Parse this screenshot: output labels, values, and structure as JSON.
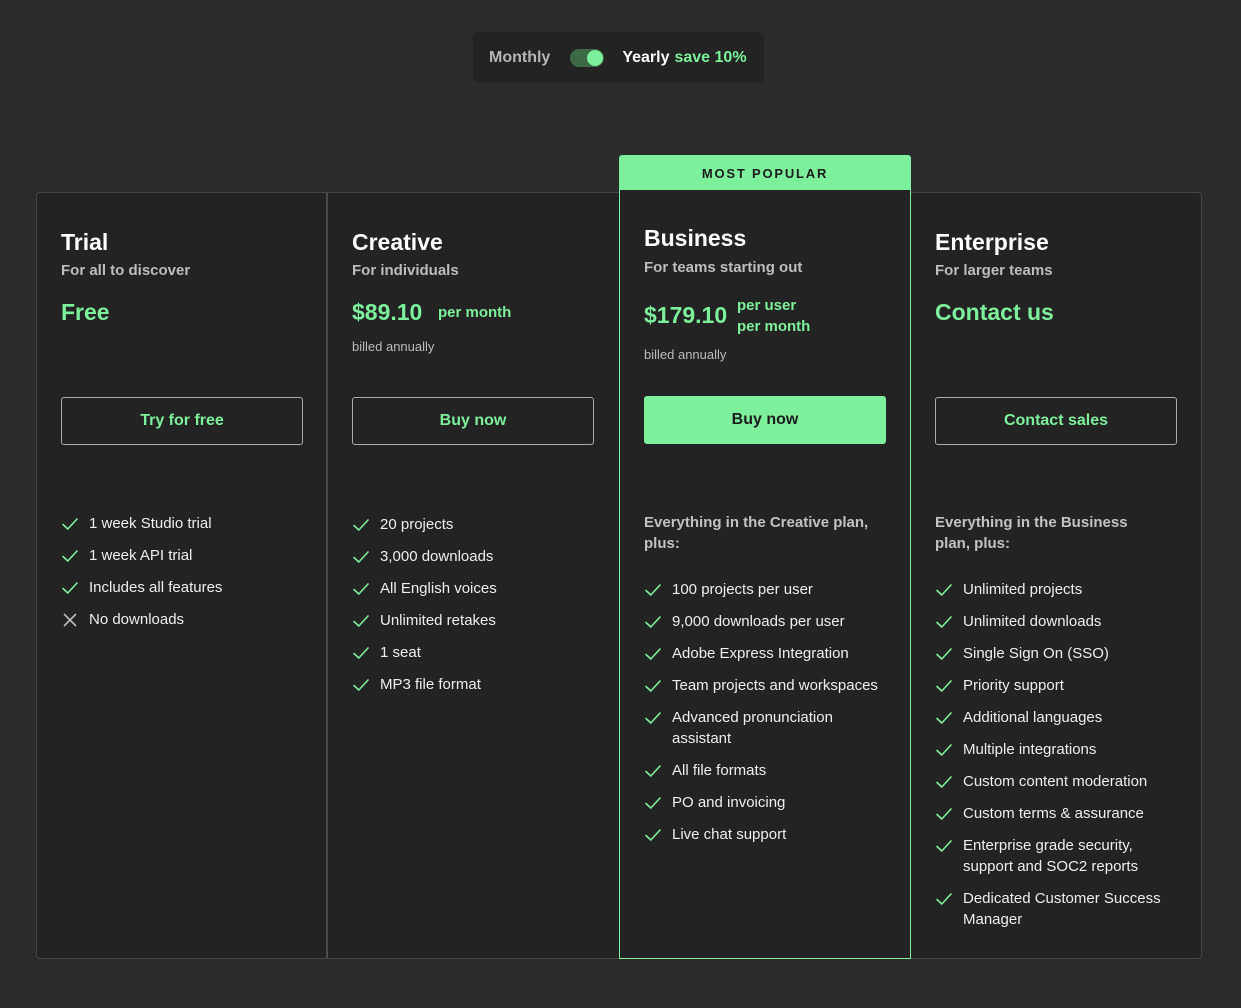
{
  "toggle": {
    "monthly": "Monthly",
    "yearly": "Yearly",
    "save": "save 10%"
  },
  "plans": [
    {
      "name": "Trial",
      "subtitle": "For all to discover",
      "price": "Free",
      "cta": "Try for free",
      "features": [
        {
          "text": "1 week Studio trial",
          "icon": "check-icon"
        },
        {
          "text": "1 week API trial",
          "icon": "check-icon"
        },
        {
          "text": "Includes all features",
          "icon": "check-icon"
        },
        {
          "text": "No downloads",
          "icon": "x-icon"
        }
      ]
    },
    {
      "name": "Creative",
      "subtitle": "For individuals",
      "price": "$89.10",
      "period": "per month",
      "billed": "billed annually",
      "cta": "Buy now",
      "features": [
        {
          "text": "20 projects",
          "icon": "check-icon"
        },
        {
          "text": "3,000 downloads",
          "icon": "check-icon"
        },
        {
          "text": "All English voices",
          "icon": "check-icon"
        },
        {
          "text": "Unlimited retakes",
          "icon": "check-icon"
        },
        {
          "text": "1 seat",
          "icon": "check-icon"
        },
        {
          "text": "MP3 file format",
          "icon": "check-icon"
        }
      ]
    },
    {
      "badge": "MOST POPULAR",
      "name": "Business",
      "subtitle": "For teams starting out",
      "price": "$179.10",
      "period_line1": "per user",
      "period_line2": "per month",
      "billed": "billed annually",
      "cta": "Buy now",
      "intro": "Everything in the Creative plan, plus:",
      "features": [
        {
          "text": "100 projects per user",
          "icon": "check-icon"
        },
        {
          "text": "9,000 downloads per user",
          "icon": "check-icon"
        },
        {
          "text": "Adobe Express Integration",
          "icon": "check-icon"
        },
        {
          "text": "Team projects and workspaces",
          "icon": "check-icon"
        },
        {
          "text": "Advanced pronunciation assistant",
          "icon": "check-icon"
        },
        {
          "text": "All file formats",
          "icon": "check-icon"
        },
        {
          "text": "PO and invoicing",
          "icon": "check-icon"
        },
        {
          "text": "Live chat support",
          "icon": "check-icon"
        }
      ]
    },
    {
      "name": "Enterprise",
      "subtitle": "For larger teams",
      "price": "Contact us",
      "cta": "Contact sales",
      "intro": "Everything in the Business plan, plus:",
      "features": [
        {
          "text": "Unlimited projects",
          "icon": "check-icon"
        },
        {
          "text": "Unlimited downloads",
          "icon": "check-icon"
        },
        {
          "text": "Single Sign On (SSO)",
          "icon": "check-icon"
        },
        {
          "text": "Priority support",
          "icon": "check-icon"
        },
        {
          "text": "Additional languages",
          "icon": "check-icon"
        },
        {
          "text": "Multiple integrations",
          "icon": "check-icon"
        },
        {
          "text": "Custom content moderation",
          "icon": "check-icon"
        },
        {
          "text": "Custom terms & assurance",
          "icon": "check-icon"
        },
        {
          "text": "Enterprise grade security, support and SOC2 reports",
          "icon": "check-icon"
        },
        {
          "text": "Dedicated Customer Success Manager",
          "icon": "check-icon"
        }
      ]
    }
  ],
  "colors": {
    "accent": "#7df09b",
    "background": "#2b2b2b",
    "card": "#232323"
  }
}
